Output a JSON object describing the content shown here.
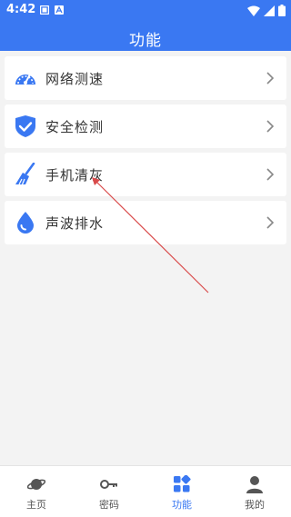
{
  "status_bar": {
    "time": "4:42"
  },
  "header": {
    "title": "功能"
  },
  "features": [
    {
      "label": "网络测速",
      "icon": "speedometer-icon"
    },
    {
      "label": "安全检测",
      "icon": "shield-check-icon"
    },
    {
      "label": "手机清灰",
      "icon": "broom-icon"
    },
    {
      "label": "声波排水",
      "icon": "water-drop-icon"
    }
  ],
  "bottom_nav": {
    "items": [
      {
        "label": "主页",
        "icon": "planet-icon"
      },
      {
        "label": "密码",
        "icon": "key-icon"
      },
      {
        "label": "功能",
        "icon": "grid-icon",
        "active": true
      },
      {
        "label": "我的",
        "icon": "user-icon"
      }
    ]
  },
  "colors": {
    "primary": "#3a78f2",
    "background": "#f3f3f3",
    "annotation": "#d94a4a"
  }
}
